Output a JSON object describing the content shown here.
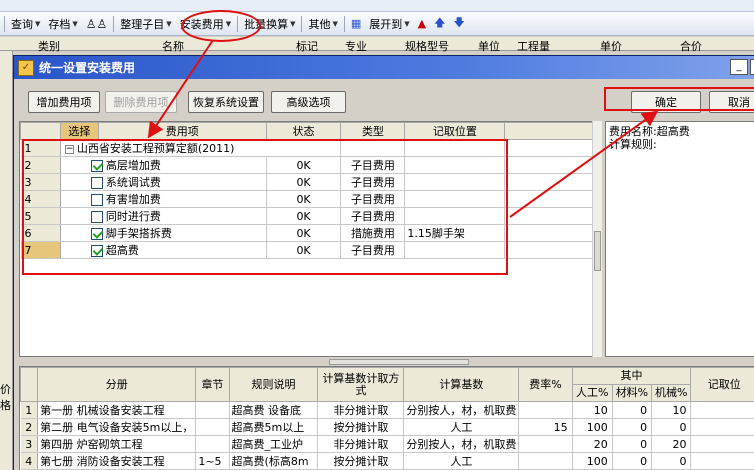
{
  "toolbar": {
    "items": [
      {
        "label": "查询",
        "dropdown": true
      },
      {
        "label": "存档",
        "dropdown": true
      },
      {
        "label": "整理子目",
        "dropdown": true
      },
      {
        "label": "安装费用",
        "dropdown": true
      },
      {
        "label": "批量换算",
        "dropdown": true
      },
      {
        "label": "其他",
        "dropdown": true
      },
      {
        "label": "展开到",
        "dropdown": true
      }
    ]
  },
  "bg_header": {
    "cols": [
      "类别",
      "名称",
      "标记",
      "专业",
      "规格型号",
      "单位",
      "工程量",
      "单价",
      "合价"
    ]
  },
  "dialog": {
    "title": "统一设置安装费用",
    "buttons": {
      "add": "增加费用项",
      "delete": "删除费用项",
      "restore": "恢复系统设置",
      "advanced": "高级选项",
      "ok": "确定",
      "cancel": "取消"
    },
    "titlebar_buttons": {
      "minimize": "_",
      "close": "×"
    },
    "upper_grid": {
      "headers": [
        "选择",
        "费用项",
        "状态",
        "类型",
        "记取位置"
      ],
      "root": {
        "num": "1",
        "label": "山西省安装工程预算定额(2011)"
      },
      "rows": [
        {
          "num": "2",
          "checked": true,
          "name": "高层增加费",
          "status": "0K",
          "type": "子目费用",
          "pos": ""
        },
        {
          "num": "3",
          "checked": false,
          "name": "系统调试费",
          "status": "0K",
          "type": "子目费用",
          "pos": ""
        },
        {
          "num": "4",
          "checked": false,
          "name": "有害增加费",
          "status": "0K",
          "type": "子目费用",
          "pos": ""
        },
        {
          "num": "5",
          "checked": false,
          "name": "同时进行费",
          "status": "0K",
          "type": "子目费用",
          "pos": ""
        },
        {
          "num": "6",
          "checked": true,
          "name": "脚手架搭拆费",
          "status": "0K",
          "type": "措施费用",
          "pos": "1.15脚手架"
        },
        {
          "num": "7",
          "checked": true,
          "name": "超高费",
          "status": "0K",
          "type": "子目费用",
          "pos": ""
        }
      ]
    },
    "right_panel": {
      "line1": "费用名称:超高费",
      "line2": "计算规则:"
    },
    "lower_grid": {
      "headers": {
        "volume": "分册",
        "chapter": "章节",
        "rule": "规则说明",
        "method": "计算基数计取方式",
        "base": "计算基数",
        "rate": "费率%",
        "group": "其中",
        "labor": "人工%",
        "material": "材料%",
        "machine": "机械%",
        "pos": "记取位"
      },
      "rows": [
        {
          "num": "1",
          "volume": "第一册 机械设备安装工程",
          "chapter": "",
          "rule": "超高费 设备底",
          "method": "非分摊计取",
          "base": "分别按人，材，机取费",
          "rate": "",
          "labor": "10",
          "material": "0",
          "machine": "10"
        },
        {
          "num": "2",
          "volume": "第二册 电气设备安装5m以上，",
          "chapter": "",
          "rule": "超高费5m以上",
          "method": "按分摊计取",
          "base": "人工",
          "rate": "15",
          "labor": "100",
          "material": "0",
          "machine": "0"
        },
        {
          "num": "3",
          "volume": "第四册 炉窑砌筑工程",
          "chapter": "",
          "rule": "超高费_工业炉",
          "method": "非分摊计取",
          "base": "分别按人，材，机取费",
          "rate": "",
          "labor": "20",
          "material": "0",
          "machine": "20"
        },
        {
          "num": "4",
          "volume": "第七册 消防设备安装工程",
          "chapter": "1~5",
          "rule": "超高费(标高8m",
          "method": "按分摊计取",
          "base": "人工",
          "rate": "",
          "labor": "100",
          "material": "0",
          "machine": "0"
        }
      ]
    }
  },
  "left_strip": {
    "label": "价格"
  },
  "colors": {
    "accent": "#e01010",
    "title_bar": "#2a55c9",
    "selected_header": "#e6c67a"
  }
}
